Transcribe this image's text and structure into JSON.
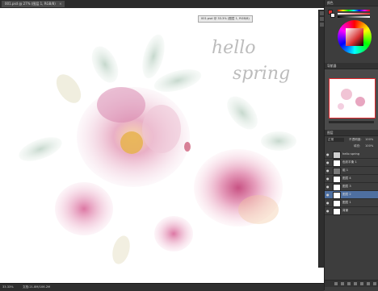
{
  "document": {
    "tab_title": "001.psd @ 27% (图层 1, RGB/8)",
    "floating_label": "001.psd @ 33.3% (图层 1, RGB/8)",
    "canvas_text_line1": "hello",
    "canvas_text_line2": "spring"
  },
  "status_bar": {
    "zoom": "33.33%",
    "doc_info": "文档:21.8M/106.2M"
  },
  "panels": {
    "color_tab": "颜色",
    "navigator_tab": "导航器",
    "layers_tab": "图层",
    "color_swatch_primary": "#d83030",
    "color_swatch_secondary": "#ffffff",
    "layers_blend_mode": "正常",
    "layers_opacity_label": "不透明度:",
    "layers_opacity_value": "100%",
    "layers_fill_label": "填充:",
    "layers_fill_value": "100%",
    "layers": [
      {
        "name": "hello spring",
        "selected": false
      },
      {
        "name": "色彩平衡 1",
        "selected": false
      },
      {
        "name": "组 1",
        "selected": false
      },
      {
        "name": "图层 4",
        "selected": false
      },
      {
        "name": "图层 3",
        "selected": false
      },
      {
        "name": "图层 2",
        "selected": true
      },
      {
        "name": "图层 1",
        "selected": false
      },
      {
        "name": "背景",
        "selected": false
      }
    ]
  },
  "colors": {
    "workspace": "#3c3c3c",
    "canvas": "#ffffff",
    "selection": "#4e6fa0",
    "navigator_frame": "#e0272d"
  }
}
